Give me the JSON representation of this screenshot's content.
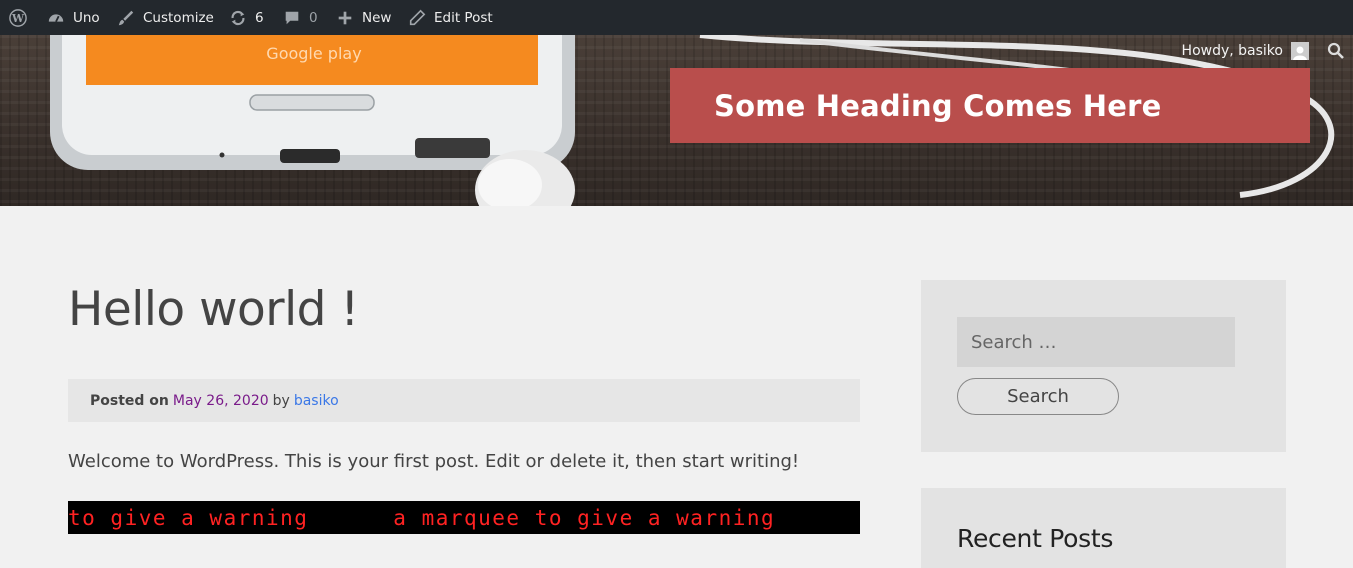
{
  "adminbar": {
    "site_name": "Uno",
    "customize": "Customize",
    "updates_count": "6",
    "comments_count": "0",
    "new_label": "New",
    "edit_post": "Edit Post"
  },
  "header": {
    "howdy": "Howdy, basiko",
    "heading": "Some Heading Comes Here"
  },
  "post": {
    "title": "Hello world !",
    "posted_on_label": "Posted on",
    "date": "May 26, 2020",
    "by_label": "by",
    "author": "basiko",
    "body": "Welcome to WordPress. This is your first post. Edit or delete it, then start writing!",
    "marquee": "to give a warning      a marquee to give a warning"
  },
  "sidebar": {
    "search_placeholder": "Search …",
    "search_button": "Search",
    "recent_posts_title": "Recent Posts"
  },
  "colors": {
    "adminbar_bg": "#23282d",
    "heading_box": "#b94e4c",
    "marquee_text": "#ff2222",
    "date_link": "#7a1b8a",
    "author_link": "#3b78e7"
  }
}
